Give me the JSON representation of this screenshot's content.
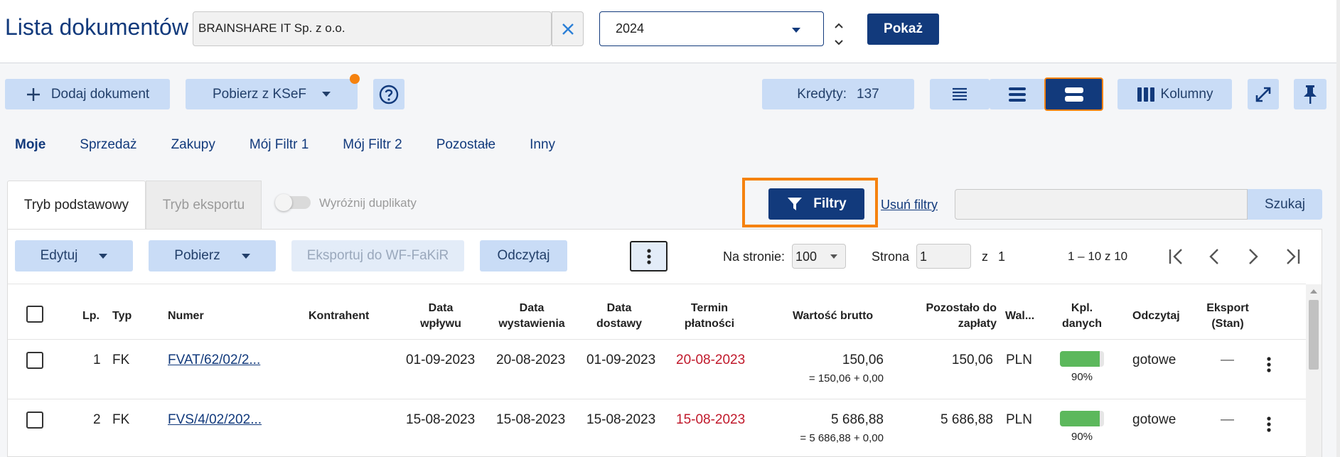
{
  "header": {
    "title": "Lista dokumentów",
    "company": "BRAINSHARE IT Sp. z o.o.",
    "year": "2024",
    "show_label": "Pokaż"
  },
  "toolbar": {
    "add_label": "Dodaj dokument",
    "ksef_label": "Pobierz z KSeF",
    "credits_label": "Kredyty:",
    "credits_value": "137",
    "columns_label": "Kolumny"
  },
  "tabs": [
    "Moje",
    "Sprzedaż",
    "Zakupy",
    "Mój Filtr 1",
    "Mój Filtr 2",
    "Pozostałe",
    "Inny"
  ],
  "modes": {
    "basic": "Tryb podstawowy",
    "export": "Tryb eksportu",
    "duplicates": "Wyróżnij duplikaty"
  },
  "filters": {
    "filter_label": "Filtry",
    "clear_label": "Usuń filtry",
    "search_label": "Szukaj",
    "search_value": ""
  },
  "actions": {
    "edit": "Edytuj",
    "download": "Pobierz",
    "export_wf": "Eksportuj do WF-FaKiR",
    "read": "Odczytaj"
  },
  "pagination": {
    "per_page_label": "Na stronie:",
    "per_page_value": "100",
    "page_label": "Strona",
    "page_value": "1",
    "of_label": "z",
    "total_pages": "1",
    "range": "1 – 10 z 10"
  },
  "table": {
    "columns": {
      "lp": "Lp.",
      "type": "Typ",
      "number": "Numer",
      "contractor": "Kontrahent",
      "received_1": "Data",
      "received_2": "wpływu",
      "issued_1": "Data",
      "issued_2": "wystawienia",
      "delivery_1": "Data",
      "delivery_2": "dostawy",
      "due_1": "Termin",
      "due_2": "płatności",
      "gross": "Wartość brutto",
      "remaining_1": "Pozostało do",
      "remaining_2": "zapłaty",
      "currency": "Wal...",
      "completeness_1": "Kpl.",
      "completeness_2": "danych",
      "read": "Odczytaj",
      "export_1": "Eksport",
      "export_2": "(Stan)"
    },
    "rows": [
      {
        "lp": "1",
        "type": "FK",
        "number": "FVAT/62/02/2...",
        "contractor": "",
        "received": "01-09-2023",
        "issued": "20-08-2023",
        "delivery": "01-09-2023",
        "due": "20-08-2023",
        "gross": "150,06",
        "gross_detail": "= 150,06 + 0,00",
        "remaining": "150,06",
        "currency": "PLN",
        "completeness": 0.9,
        "completeness_label": "90%",
        "read": "gotowe",
        "export": "—"
      },
      {
        "lp": "2",
        "type": "FK",
        "number": "FVS/4/02/202...",
        "contractor": "",
        "received": "15-08-2023",
        "issued": "15-08-2023",
        "delivery": "15-08-2023",
        "due": "15-08-2023",
        "gross": "5 686,88",
        "gross_detail": "= 5 686,88 + 0,00",
        "remaining": "5 686,88",
        "currency": "PLN",
        "completeness": 0.9,
        "completeness_label": "90%",
        "read": "gotowe",
        "export": "—"
      }
    ]
  },
  "colors": {
    "primary": "#123a7c",
    "accent_orange": "#f5820f",
    "overdue_red": "#c0192b",
    "progress_green": "#5cb85c"
  }
}
